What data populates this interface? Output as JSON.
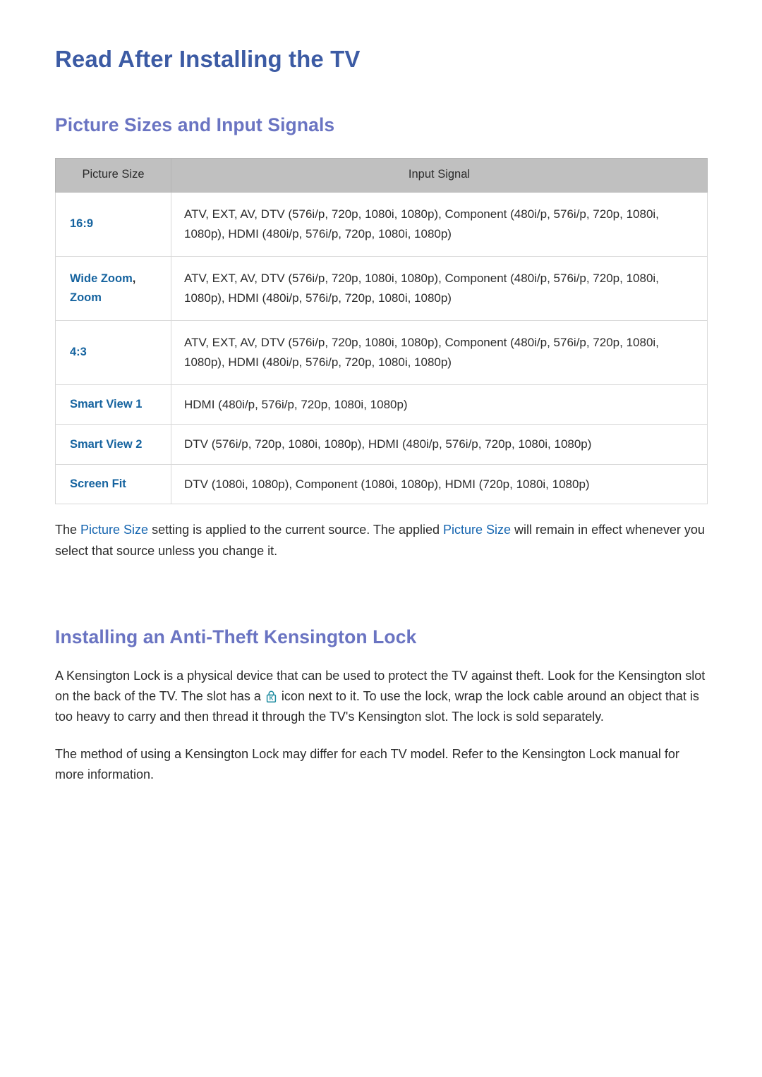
{
  "document": {
    "title": "Read After Installing the TV"
  },
  "sections": [
    {
      "heading": "Picture Sizes and Input Signals",
      "table": {
        "headers": [
          "Picture Size",
          "Input Signal"
        ],
        "rows": [
          {
            "size": "16:9",
            "size_suffix": "",
            "signal": "ATV, EXT, AV, DTV (576i/p, 720p, 1080i, 1080p), Component (480i/p, 576i/p, 720p, 1080i, 1080p), HDMI (480i/p, 576i/p, 720p, 1080i, 1080p)"
          },
          {
            "size": "Wide Zoom",
            "size_suffix": ",",
            "size_line2": "Zoom",
            "signal": "ATV, EXT, AV, DTV (576i/p, 720p, 1080i, 1080p), Component (480i/p, 576i/p, 720p, 1080i, 1080p), HDMI (480i/p, 576i/p, 720p, 1080i, 1080p)"
          },
          {
            "size": "4:3",
            "size_suffix": "",
            "signal": "ATV, EXT, AV, DTV (576i/p, 720p, 1080i, 1080p), Component (480i/p, 576i/p, 720p, 1080i, 1080p), HDMI (480i/p, 576i/p, 720p, 1080i, 1080p)"
          },
          {
            "size": "Smart View 1",
            "size_suffix": "",
            "signal": "HDMI (480i/p, 576i/p, 720p, 1080i, 1080p)"
          },
          {
            "size": "Smart View 2",
            "size_suffix": "",
            "signal": "DTV (576i/p, 720p, 1080i, 1080p), HDMI (480i/p, 576i/p, 720p, 1080i, 1080p)"
          },
          {
            "size": "Screen Fit",
            "size_suffix": "",
            "signal": "DTV (1080i, 1080p), Component (1080i, 1080p), HDMI (720p, 1080i, 1080p)"
          }
        ]
      },
      "note": {
        "part1": "The ",
        "term1": "Picture Size",
        "part2": " setting is applied to the current source. The applied ",
        "term2": "Picture Size",
        "part3": " will remain in effect whenever you select that source unless you change it."
      }
    },
    {
      "heading": "Installing an Anti-Theft Kensington Lock",
      "paragraph1": {
        "part1": "A Kensington Lock is a physical device that can be used to protect the TV against theft. Look for the Kensington slot on the back of the TV. The slot has a ",
        "icon": "kensington-lock-icon",
        "part2": " icon next to it. To use the lock, wrap the lock cable around an object that is too heavy to carry and then thread it through the TV's Kensington slot. The lock is sold separately."
      },
      "paragraph2": "The method of using a Kensington Lock may differ for each TV model. Refer to the Kensington Lock manual for more information."
    }
  ],
  "colors": {
    "page_title": "#3c5ba4",
    "section_heading": "#6a74c2",
    "table_label": "#15639f",
    "inline_highlight": "#1565b0",
    "table_header_bg": "#c0c0c0",
    "lock_icon": "#1d8ba0",
    "body_text": "#2b2b2b"
  }
}
